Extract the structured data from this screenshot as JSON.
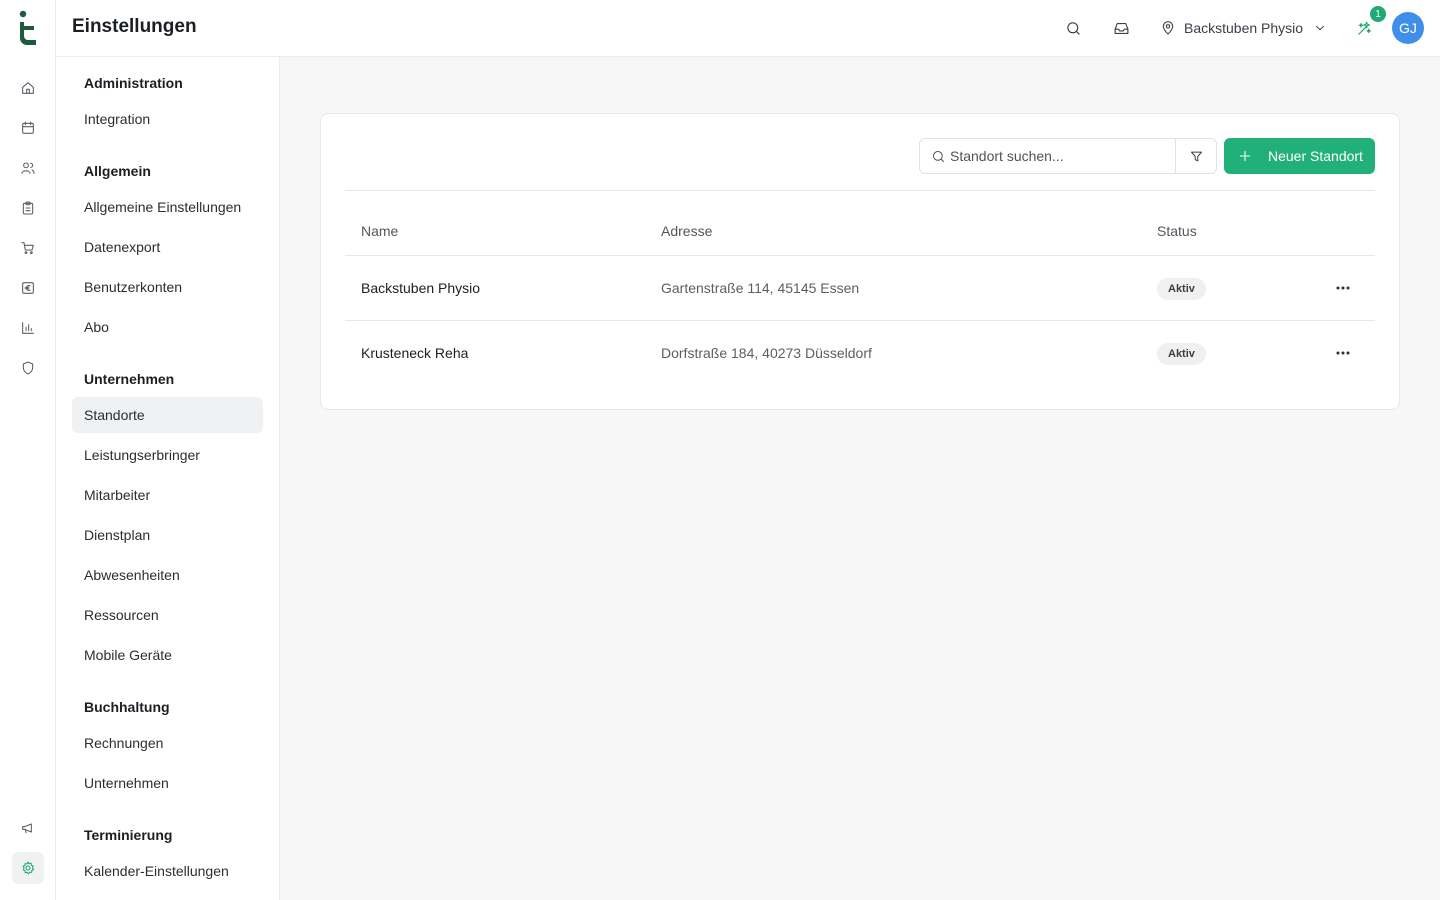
{
  "topbar": {
    "title": "Einstellungen",
    "location": "Backstuben Physio",
    "notification_count": "1",
    "avatar_initials": "GJ"
  },
  "rail": {
    "icons": [
      "home-icon",
      "calendar-icon",
      "users-icon",
      "clipboard-icon",
      "cart-icon",
      "euro-icon",
      "bar-chart-icon",
      "shield-icon",
      "megaphone-icon",
      "gear-icon"
    ],
    "accent_color": "#1faa74"
  },
  "settings_nav": {
    "groups": [
      {
        "heading": "Administration",
        "items": [
          "Integration"
        ]
      },
      {
        "heading": "Allgemein",
        "items": [
          "Allgemeine Einstellungen",
          "Datenexport",
          "Benutzerkonten",
          "Abo"
        ]
      },
      {
        "heading": "Unternehmen",
        "items": [
          "Standorte",
          "Leistungserbringer",
          "Mitarbeiter",
          "Dienstplan",
          "Abwesenheiten",
          "Ressourcen",
          "Mobile Geräte"
        ]
      },
      {
        "heading": "Buchhaltung",
        "items": [
          "Rechnungen",
          "Unternehmen"
        ]
      },
      {
        "heading": "Terminierung",
        "items": [
          "Kalender-Einstellungen"
        ]
      }
    ],
    "active_item": "Standorte"
  },
  "locations": {
    "search_placeholder": "Standort suchen...",
    "new_button_label": "Neuer Standort",
    "columns": [
      "Name",
      "Adresse",
      "Status"
    ],
    "rows": [
      {
        "name": "Backstuben Physio",
        "address": "Gartenstraße 114, 45145 Essen",
        "status": "Aktiv"
      },
      {
        "name": "Krusteneck Reha",
        "address": "Dorfstraße 184, 40273 Düsseldorf",
        "status": "Aktiv"
      }
    ],
    "primary_color": "#21b178"
  }
}
